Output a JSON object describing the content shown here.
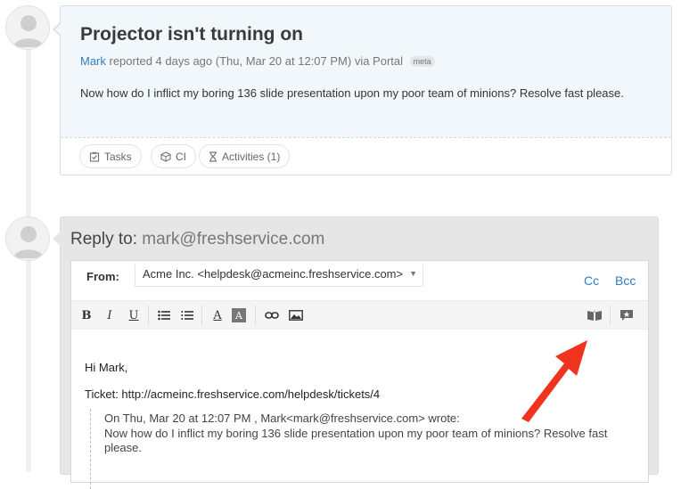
{
  "ticket": {
    "title": "Projector isn't turning on",
    "author": "Mark",
    "reported_text": " reported 4 days ago (Thu, Mar 20 at 12:07 PM) via Portal ",
    "meta_badge": "meta",
    "description": "Now how do I inflict my boring 136 slide presentation upon my poor team of minions? Resolve fast please.",
    "actions": [
      {
        "label": "Tasks",
        "icon": "tasks-icon"
      },
      {
        "label": "CI",
        "icon": "ci-icon"
      },
      {
        "label": "Activities (1)",
        "icon": "hourglass-icon"
      }
    ]
  },
  "reply": {
    "label": "Reply to: ",
    "email": "mark@freshservice.com",
    "from_label": "From:",
    "from_value": "Acme Inc. <helpdesk@acmeinc.freshservice.com>",
    "cc_label": "Cc",
    "bcc_label": "Bcc",
    "toolbar": {
      "bold": "B",
      "italic": "I",
      "underline": "U",
      "font_color": "A",
      "highlight": "A"
    },
    "body": {
      "greeting": "Hi Mark,",
      "ticket_line": "Ticket: http://acmeinc.freshservice.com/helpdesk/tickets/4",
      "quote_header": "On Thu, Mar 20 at 12:07 PM , Mark<mark@freshservice.com> wrote:",
      "quote_text": "Now how do I inflict my boring 136 slide presentation upon my poor team of minions? Resolve fast please."
    }
  },
  "colors": {
    "link": "#2d7dc2",
    "ticket_bg": "#f1f7fb",
    "reply_bg": "#e6e6e6",
    "annotation_arrow": "#f0331f"
  }
}
